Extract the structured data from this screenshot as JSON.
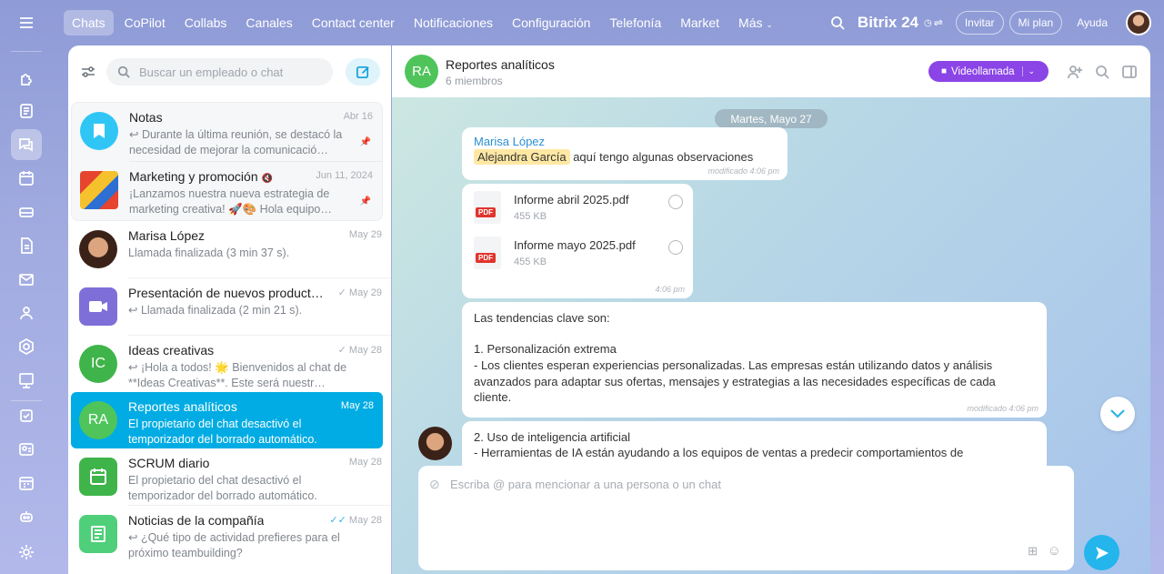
{
  "topnav": {
    "items": [
      "Chats",
      "CoPilot",
      "Collabs",
      "Canales",
      "Contact center",
      "Notificaciones",
      "Configuración",
      "Telefonía",
      "Market",
      "Más"
    ],
    "logo": "Bitrix 24",
    "invite": "Invitar",
    "my_plan": "Mi plan",
    "help": "Ayuda"
  },
  "list": {
    "search_placeholder": "Buscar un empleado o chat",
    "chats": [
      {
        "title": "Notas",
        "date": "Abr 16",
        "preview": "Durante la última reunión, se destacó la necesidad de mejorar la comunicació…",
        "avatar_color": "#2fc6f6"
      },
      {
        "title": "Marketing y promoción",
        "date": "Jun 11, 2024",
        "preview": "¡Lanzamos nuestra nueva estrategia de marketing creativa! 🚀🎨 Hola equipo…"
      },
      {
        "title": "Marisa López",
        "date": "May 29",
        "preview": "Llamada finalizada (3 min 37 s)."
      },
      {
        "title": "Presentación de nuevos product…",
        "date": "May 29",
        "preview": "Llamada finalizada (2 min 21 s).",
        "avatar_color": "#7e6fd8"
      },
      {
        "title": "Ideas creativas",
        "date": "May 28",
        "preview": "¡Hola a todos! 🌟 Bienvenidos al chat de **Ideas Creativas**. Este será nuestr…",
        "initials": "IC",
        "avatar_color": "#3fb44a"
      },
      {
        "title": "Reportes analíticos",
        "date": "May 28",
        "preview": "El propietario del chat desactivó el temporizador del borrado automático.",
        "initials": "RA",
        "avatar_color": "#4fc45b"
      },
      {
        "title": "SCRUM diario",
        "date": "May 28",
        "preview": "El propietario del chat desactivó el temporizador del borrado automático.",
        "avatar_color": "#3fb44a"
      },
      {
        "title": "Noticias de la compañía",
        "date": "May 28",
        "preview": "¿Qué tipo de actividad prefieres para el próximo teambuilding?",
        "avatar_color": "#4fcf7a"
      }
    ]
  },
  "chat": {
    "title": "Reportes analíticos",
    "members": "6 miembros",
    "initials": "RA",
    "video_call": "Videollamada",
    "date_divider": "Martes, Mayo 27",
    "msg1": {
      "author": "Marisa López",
      "mention": "Alejandra García",
      "text": "aquí tengo algunas observaciones",
      "meta": "modificado 4:06 pm"
    },
    "files": [
      {
        "name": "Informe abril 2025.pdf",
        "size": "455 KB",
        "ext": "PDF"
      },
      {
        "name": "Informe mayo 2025.pdf",
        "size": "455 KB",
        "ext": "PDF"
      }
    ],
    "files_time": "4:06 pm",
    "msg3": {
      "line1": "Las tendencias clave son:",
      "line2": "1. Personalización extrema",
      "line3": "- Los clientes esperan experiencias personalizadas. Las empresas están utilizando datos y análisis avanzados para adaptar sus ofertas, mensajes y estrategias a las necesidades específicas de cada cliente.",
      "meta": "modificado 4:06 pm"
    },
    "msg4": {
      "line1": "2. Uso de inteligencia artificial",
      "line2": "- Herramientas de IA están ayudando a los equipos de ventas a predecir comportamientos de"
    },
    "composer_placeholder": "Escriba @ para mencionar a una persona o un chat"
  }
}
